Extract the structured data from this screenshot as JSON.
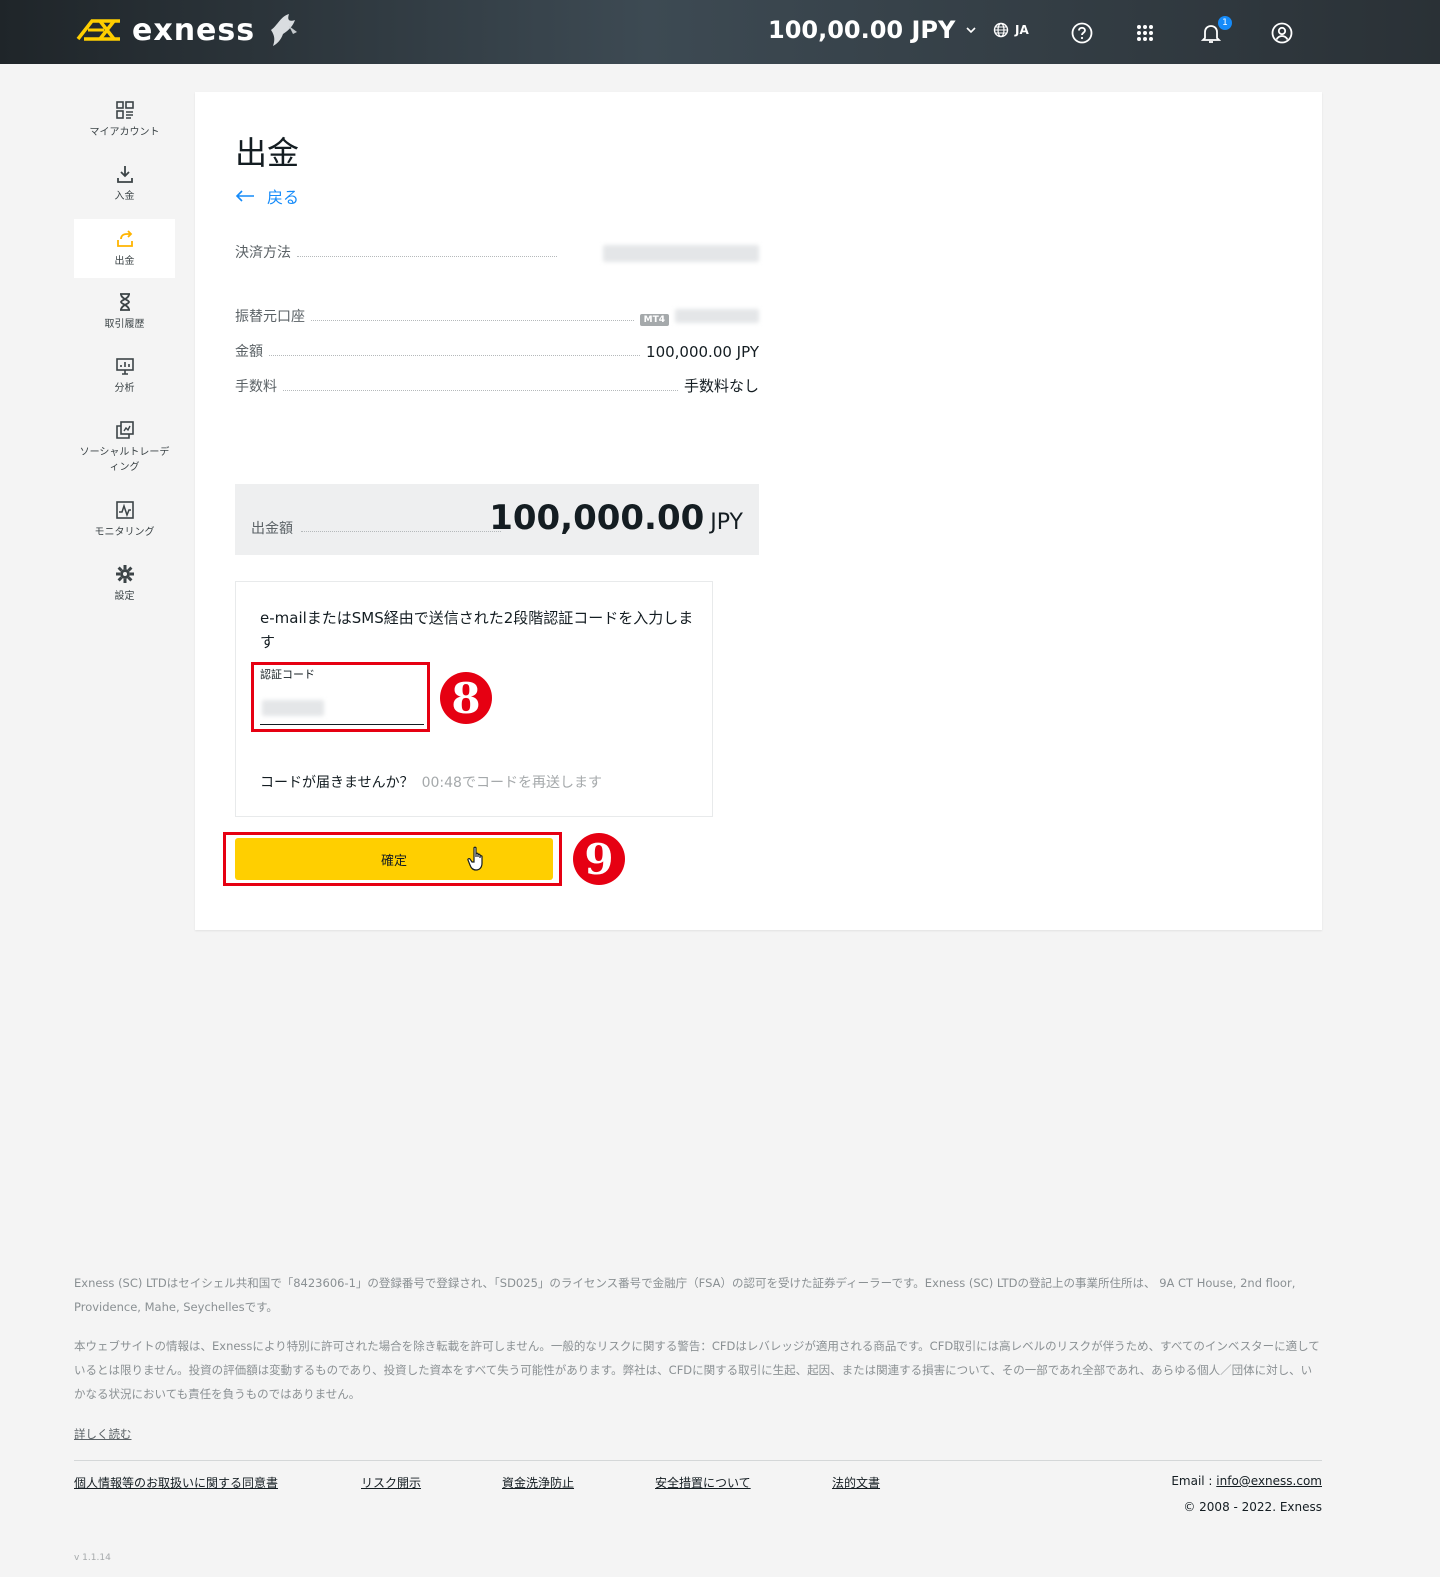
{
  "header": {
    "brand": "exness",
    "balance": "100,00.00 JPY",
    "language": "JA",
    "notification_count": "1"
  },
  "sidebar": {
    "items": [
      {
        "label": "マイアカウント",
        "icon": "dashboard-icon"
      },
      {
        "label": "入金",
        "icon": "download-icon"
      },
      {
        "label": "出金",
        "icon": "upload-icon"
      },
      {
        "label": "取引履歴",
        "icon": "hourglass-icon"
      },
      {
        "label": "分析",
        "icon": "presentation-icon"
      },
      {
        "label": "ソーシャルトレーディング",
        "icon": "copy-icon"
      },
      {
        "label": "モニタリング",
        "icon": "monitor-icon"
      },
      {
        "label": "設定",
        "icon": "gear-icon"
      }
    ]
  },
  "page": {
    "title": "出金",
    "back_label": "戻る",
    "payment_method_label": "決済方法",
    "source_account_label": "振替元口座",
    "account_type": "MT4",
    "amount_label": "金額",
    "amount_value": "100,000.00 JPY",
    "fee_label": "手数料",
    "fee_value": "手数料なし",
    "withdraw_amount_label": "出金額",
    "withdraw_amount": "100,000.00",
    "withdraw_currency": "JPY"
  },
  "auth": {
    "description": "e-mailまたはSMS経由で送信された2段階認証コードを入力します",
    "code_label": "認証コード",
    "no_code_text": "コードが届きませんか？",
    "resend_text": "00:48でコードを再送します"
  },
  "confirm_label": "確定",
  "annotations": {
    "step_8": "8",
    "step_9": "9"
  },
  "footer": {
    "legal_1": "Exness (SC) LTDはセイシェル共和国で「8423606-1」の登録番号で登録され、「SD025」のライセンス番号で金融庁（FSA）の認可を受けた証券ディーラーです。Exness (SC) LTDの登記上の事業所住所は、 9A CT House, 2nd floor, Providence, Mahe, Seychellesです。",
    "legal_2": "本ウェブサイトの情報は、Exnessにより特別に許可された場合を除き転載を許可しません。一般的なリスクに関する警告：CFDはレバレッジが適用される商品です。CFD取引には高レベルのリスクが伴うため、すべてのインベスターに適しているとは限りません。投資の評価額は変動するものであり、投資した資本をすべて失う可能性があります。弊社は、CFDに関する取引に生起、起因、または関連する損害について、その一部であれ全部であれ、あらゆる個人／団体に対し、いかなる状況においても責任を負うものではありません。",
    "read_more": "詳しく読む",
    "links": [
      "個人情報等のお取扱いに関する同意書",
      "リスク開示",
      "資金洗浄防止",
      "安全措置について",
      "法的文書"
    ],
    "email_label": "Email : ",
    "email": "info@exness.com",
    "copyright": "© 2008 - 2022. Exness",
    "version": "v 1.1.14"
  },
  "colors": {
    "accent_yellow": "#ffcf00",
    "link_blue": "#158bf9",
    "annotation_red": "#e60012"
  }
}
